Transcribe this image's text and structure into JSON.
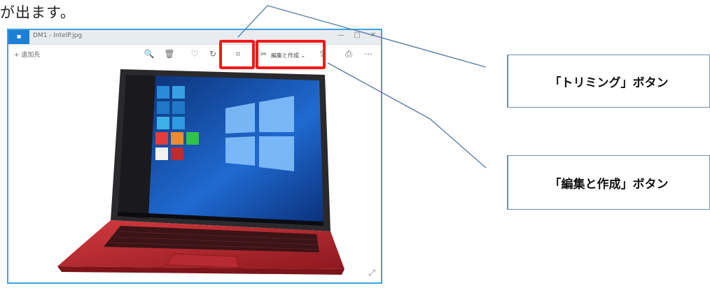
{
  "intro_text": "が出ます。",
  "window": {
    "title": "DM1 - IntelP.jpg",
    "app_icon": "photos-app-icon",
    "controls": [
      "—",
      "□",
      "✕"
    ]
  },
  "toolbar": {
    "add_favorite_label": "+ 追加先",
    "zoom_icon": "🔍",
    "delete_icon": "🗑",
    "favorite_icon": "♡",
    "rotate_icon": "↻",
    "crop_icon": "⌗",
    "edit_icon": "✂",
    "edit_create_label": "編集と作成 ⌄",
    "share_icon": "⇪",
    "print_icon": "⎙",
    "more_icon": "⋯"
  },
  "callouts": {
    "trim_button": "「トリミング」ボタン",
    "edit_create_button": "「編集と作成」ボタン"
  },
  "colors": {
    "window_border": "#3aa3e0",
    "highlight_red": "#f01a1a",
    "laptop_red": "#b3202a",
    "callout_line": "#5a7ea6"
  }
}
